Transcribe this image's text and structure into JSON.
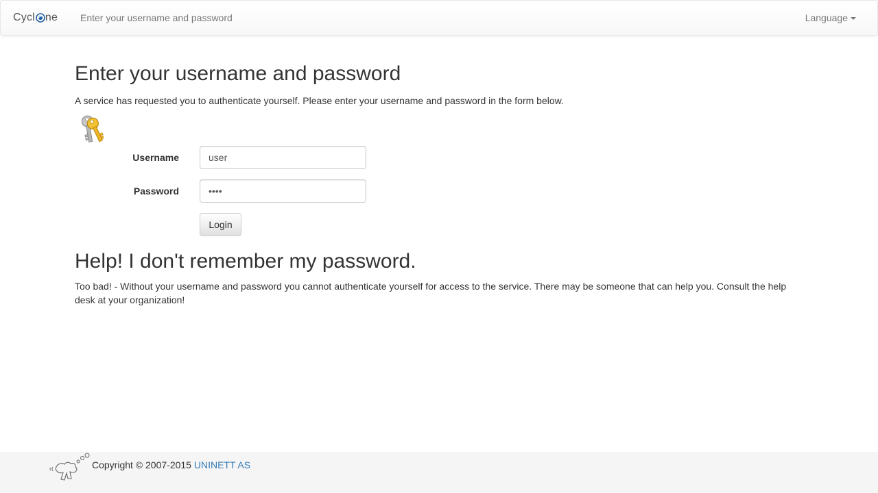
{
  "navbar": {
    "brand": "Cyclone",
    "brand_prefix": "Cycl",
    "brand_suffix": "ne",
    "title": "Enter your username and password",
    "language_label": "Language"
  },
  "main": {
    "heading": "Enter your username and password",
    "intro": "A service has requested you to authenticate yourself. Please enter your username and password in the form below.",
    "username_label": "Username",
    "username_value": "user",
    "password_label": "Password",
    "password_value": "pass",
    "login_button": "Login",
    "help_heading": "Help! I don't remember my password.",
    "help_text": "Too bad! - Without your username and password you cannot authenticate yourself for access to the service. There may be someone that can help you. Consult the help desk at your organization!"
  },
  "footer": {
    "copyright": "Copyright © 2007-2015",
    "link_text": "UNINETT AS"
  },
  "colors": {
    "link": "#337ab7",
    "brand_globe": "#1f5fa8",
    "footer_bg": "#f5f5f5"
  },
  "icons": {
    "brand": "globe-icon",
    "form": "keys-icon",
    "footer": "uninett-mascot-icon"
  }
}
